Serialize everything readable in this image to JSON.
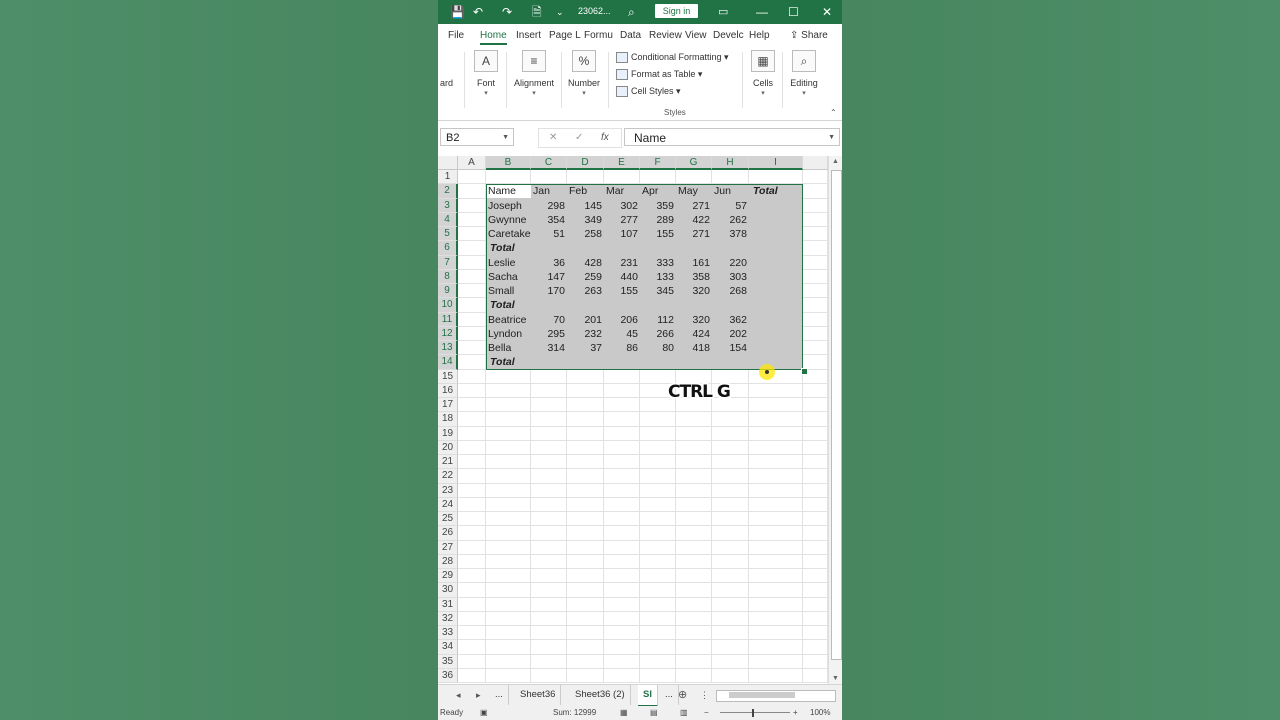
{
  "title_bar": {
    "file_name": "23062...",
    "sign_in_label": "Sign in"
  },
  "tabs": [
    {
      "label": "File"
    },
    {
      "label": "Home"
    },
    {
      "label": "Insert"
    },
    {
      "label": "Page L"
    },
    {
      "label": "Formu"
    },
    {
      "label": "Data"
    },
    {
      "label": "Review"
    },
    {
      "label": "View"
    },
    {
      "label": "Develc"
    },
    {
      "label": "Help"
    }
  ],
  "share_label": "Share",
  "ribbon": {
    "clipboard_partial": "ard",
    "font_label": "Font",
    "alignment_label": "Alignment",
    "number_label": "Number",
    "conditional_formatting": "Conditional Formatting",
    "format_as_table": "Format as Table",
    "cell_styles": "Cell Styles",
    "styles_group": "Styles",
    "cells_label": "Cells",
    "editing_label": "Editing"
  },
  "formula_bar": {
    "name_box": "B2",
    "fx": "fx",
    "content": "Name"
  },
  "columns": [
    "A",
    "B",
    "C",
    "D",
    "E",
    "F",
    "G",
    "H",
    "I"
  ],
  "rows": [
    "1",
    "2",
    "3",
    "4",
    "5",
    "6",
    "7",
    "8",
    "9",
    "10",
    "11",
    "12",
    "13",
    "14",
    "15",
    "16",
    "17",
    "18",
    "19",
    "20",
    "21",
    "22",
    "23",
    "24",
    "25",
    "26",
    "27",
    "28",
    "29",
    "30",
    "31",
    "32",
    "33",
    "34",
    "35",
    "36"
  ],
  "header_row": [
    "Name",
    "Jan",
    "Feb",
    "Mar",
    "Apr",
    "May",
    "Jun",
    "Total"
  ],
  "table_rows": [
    {
      "name": "Joseph",
      "values": [
        "298",
        "145",
        "302",
        "359",
        "271",
        "57"
      ]
    },
    {
      "name": "Gwynne",
      "values": [
        "354",
        "349",
        "277",
        "289",
        "422",
        "262"
      ]
    },
    {
      "name": "Caretake",
      "values": [
        "51",
        "258",
        "107",
        "155",
        "271",
        "378"
      ]
    },
    {
      "name": "Total",
      "total": true,
      "values": []
    },
    {
      "name": "Leslie",
      "values": [
        "36",
        "428",
        "231",
        "333",
        "161",
        "220"
      ]
    },
    {
      "name": "Sacha",
      "values": [
        "147",
        "259",
        "440",
        "133",
        "358",
        "303"
      ]
    },
    {
      "name": "Small",
      "values": [
        "170",
        "263",
        "155",
        "345",
        "320",
        "268"
      ]
    },
    {
      "name": "Total",
      "total": true,
      "values": []
    },
    {
      "name": "Beatrice",
      "values": [
        "70",
        "201",
        "206",
        "112",
        "320",
        "362"
      ]
    },
    {
      "name": "Lyndon",
      "values": [
        "295",
        "232",
        "45",
        "266",
        "424",
        "202"
      ]
    },
    {
      "name": "Bella",
      "values": [
        "314",
        "37",
        "86",
        "80",
        "418",
        "154"
      ]
    },
    {
      "name": "Total",
      "total": true,
      "values": []
    }
  ],
  "overlay_text": "CTRL G",
  "sheet_tabs": [
    {
      "label": "...",
      "active": false
    },
    {
      "label": "Sheet36",
      "active": false
    },
    {
      "label": "Sheet36 (2)",
      "active": false
    },
    {
      "label": "Sl",
      "active": true
    },
    {
      "label": "...",
      "active": false
    }
  ],
  "status": {
    "ready": "Ready",
    "sum": "Sum: 12999",
    "zoom": "100%"
  }
}
